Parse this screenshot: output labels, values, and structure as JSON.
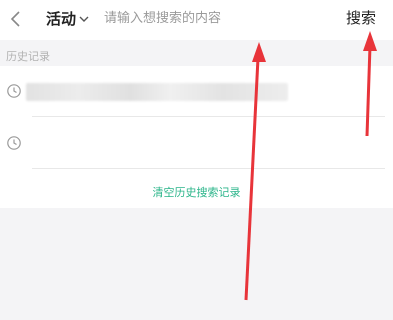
{
  "topbar": {
    "category": "活动",
    "search_placeholder": "请输入想搜索的内容",
    "search_value": "",
    "search_button": "搜索"
  },
  "history": {
    "title": "历史记录",
    "items": [
      {
        "text": ""
      },
      {
        "text": ""
      }
    ],
    "clear_label": "清空历史搜索记录"
  },
  "colors": {
    "accent": "#2bb58a",
    "annotation": "#e8343a",
    "background": "#f4f4f6"
  }
}
